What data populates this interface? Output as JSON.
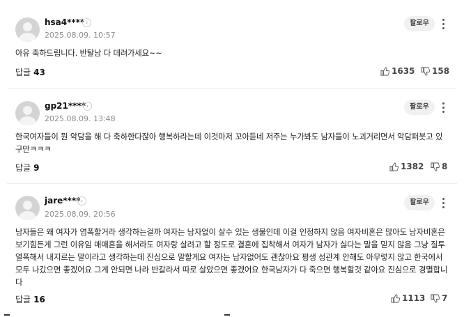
{
  "follow_label": "팔로우",
  "reply_label": "답글",
  "icons": {
    "arrow": "chevron-right-icon",
    "more": "more-vertical-icon",
    "like": "thumbs-up-icon",
    "dislike": "thumbs-down-icon"
  },
  "comments": [
    {
      "nickname": "hsa4****",
      "date": "2025.08.09. 10:57",
      "text": "아유 축하드립니다. 반탈남 다 데려가세요~~",
      "reply_count": "43",
      "likes": "1635",
      "dislikes": "158"
    },
    {
      "nickname": "gp21****",
      "date": "2025.08.09. 13:48",
      "text": "한국여자들이 뭔 악담을 해 다 축하한다잖아 행복하라는데 이것마저 꼬아듣네 저주는 누가봐도 남자들이 노괴거리면서 악담퍼붓고 있구만ㅋㅋㅋ",
      "reply_count": "9",
      "likes": "1382",
      "dislikes": "8"
    },
    {
      "nickname": "jare****",
      "date": "2025.08.09. 20:56",
      "text": "남자들은 왜 여자가 염폭할거라 생각하는걸까 여자는 남자없이 살수 있는 생물인데 이걸 인정하지 않음 여자비혼은 많아도 남자비혼은 보기힘든게 그런 이유임 매매혼을 해서라도 여자랑 살려고 할 정도로 결혼에 집착해서 여자가 남자가 싫다는 말을 믿지 않음 그냥 질투 열폭해서 내지르는 말이라고 생각하는데 진심으로 말할게요 여자는 남자없어도 괜찮아요 평생 성관계 안해도 아무렇지 않고 한국에서 모두 나갔으면 좋겠어요 그게 안되면 나라 반갈라서 따로 살았으면 좋겠어요 한국남자가 다 죽으면 행복할것 같아요 진심으로 경멸합니다",
      "reply_count": "16",
      "likes": "1113",
      "dislikes": "7"
    }
  ]
}
